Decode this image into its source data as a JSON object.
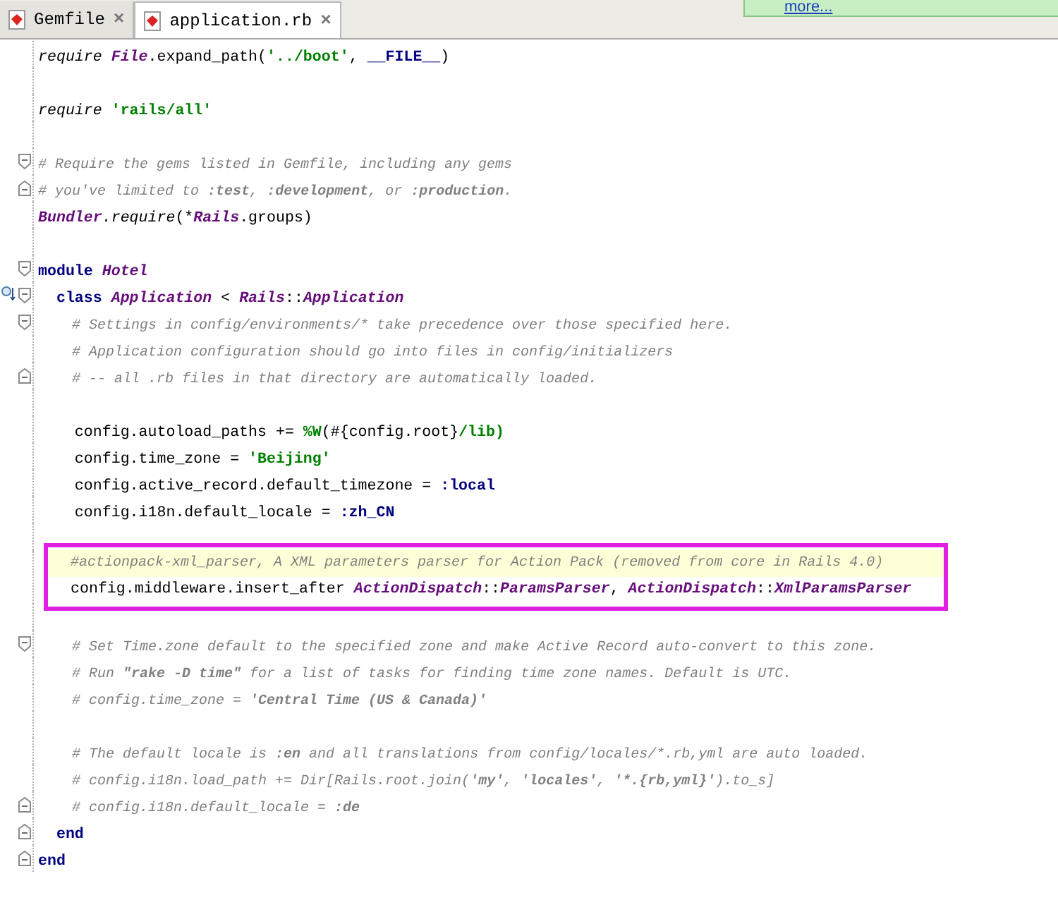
{
  "tabs": [
    {
      "label": "Gemfile",
      "close": "×",
      "selected": false
    },
    {
      "label": "application.rb",
      "close": "×",
      "selected": true
    }
  ],
  "notification": {
    "link": "more..."
  },
  "lines": [
    {
      "kind": "plain",
      "current": false,
      "segments": [
        {
          "kind": "meth",
          "text": "require "
        },
        {
          "kind": "const",
          "text": "File"
        },
        {
          "kind": "t",
          "text": ".expand_path("
        },
        {
          "kind": "str",
          "text": "'../boot'"
        },
        {
          "kind": "t",
          "text": ", "
        },
        {
          "kind": "kw",
          "text": "__FILE__"
        },
        {
          "kind": "t",
          "text": ")"
        }
      ]
    },
    {
      "kind": "plain",
      "current": false
    },
    {
      "kind": "plain",
      "current": false,
      "segments": [
        {
          "kind": "meth",
          "text": "require "
        },
        {
          "kind": "str",
          "text": "'rails/all'"
        }
      ]
    },
    {
      "kind": "plain",
      "current": false
    },
    {
      "kind": "opener",
      "current": false,
      "segments": [
        {
          "kind": "cmt",
          "text": "# Require the gems listed in Gemfile, including any gems"
        }
      ]
    },
    {
      "kind": "closer",
      "current": false,
      "segments": [
        {
          "kind": "cmt",
          "text": "# you've limited to "
        },
        {
          "kind": "cmtb",
          "text": ":test"
        },
        {
          "kind": "cmt",
          "text": ", "
        },
        {
          "kind": "cmtb",
          "text": ":development"
        },
        {
          "kind": "cmt",
          "text": ", or "
        },
        {
          "kind": "cmtb",
          "text": ":production"
        },
        {
          "kind": "cmt",
          "text": "."
        }
      ]
    },
    {
      "kind": "plain",
      "current": false,
      "segments": [
        {
          "kind": "const",
          "text": "Bundler"
        },
        {
          "kind": "meth",
          "text": ".require"
        },
        {
          "kind": "t",
          "text": "(*"
        },
        {
          "kind": "const",
          "text": "Rails"
        },
        {
          "kind": "t",
          "text": ".groups)"
        }
      ]
    },
    {
      "kind": "plain",
      "current": false
    },
    {
      "kind": "opener",
      "current": false,
      "segments": [
        {
          "kind": "kw",
          "text": "module "
        },
        {
          "kind": "const",
          "text": "Hotel"
        }
      ]
    },
    {
      "kind": "opener",
      "current": false,
      "overridden": true,
      "segments": [
        {
          "kind": "kw",
          "text": "  class "
        },
        {
          "kind": "const",
          "text": "Application"
        },
        {
          "kind": "t",
          "text": " < "
        },
        {
          "kind": "const",
          "text": "Rails"
        },
        {
          "kind": "t",
          "text": "::"
        },
        {
          "kind": "const",
          "text": "Application"
        }
      ]
    },
    {
      "kind": "opener",
      "current": false,
      "segments": [
        {
          "kind": "cmt",
          "text": "    # Settings in config/environments/* take precedence over those specified here."
        }
      ]
    },
    {
      "kind": "plain",
      "current": false,
      "segments": [
        {
          "kind": "cmt",
          "text": "    # Application configuration should go into files in config/initializers"
        }
      ]
    },
    {
      "kind": "closer",
      "current": false,
      "segments": [
        {
          "kind": "cmt",
          "text": "    # -- all .rb files in that directory are automatically loaded."
        }
      ]
    },
    {
      "kind": "plain",
      "current": false
    },
    {
      "kind": "plain",
      "current": false,
      "segments": [
        {
          "kind": "t",
          "text": "    config.autoload_paths += "
        },
        {
          "kind": "str",
          "text": "%W"
        },
        {
          "kind": "t",
          "text": "(#{config.root}"
        },
        {
          "kind": "str",
          "text": "/lib)"
        }
      ]
    },
    {
      "kind": "plain",
      "current": false,
      "segments": [
        {
          "kind": "t",
          "text": "    config.time_zone = "
        },
        {
          "kind": "str",
          "text": "'Beijing'"
        }
      ]
    },
    {
      "kind": "plain",
      "current": false,
      "segments": [
        {
          "kind": "t",
          "text": "    config.active_record.default_timezone = "
        },
        {
          "kind": "sym",
          "text": ":local"
        }
      ]
    },
    {
      "kind": "plain",
      "current": false,
      "segments": [
        {
          "kind": "t",
          "text": "    config.i18n.default_locale = "
        },
        {
          "kind": "sym",
          "text": ":zh_CN"
        }
      ]
    },
    {
      "kind": "plain",
      "current": false
    },
    {
      "kind": "box",
      "lines": [
        {
          "current": true,
          "segments": [
            {
              "kind": "cmt",
              "text": "#actionpack-xml_parser, A XML parameters parser for Action Pack (removed from core in Rails 4.0)"
            }
          ]
        },
        {
          "current": false,
          "segments": [
            {
              "kind": "t",
              "text": "config.middleware.insert_after "
            },
            {
              "kind": "const",
              "text": "ActionDispatch"
            },
            {
              "kind": "t",
              "text": "::"
            },
            {
              "kind": "const",
              "text": "ParamsParser"
            },
            {
              "kind": "t",
              "text": ", "
            },
            {
              "kind": "const",
              "text": "ActionDispatch"
            },
            {
              "kind": "t",
              "text": "::"
            },
            {
              "kind": "const",
              "text": "XmlParamsParser"
            }
          ]
        }
      ]
    },
    {
      "kind": "plain",
      "current": false
    },
    {
      "kind": "opener",
      "current": false,
      "segments": [
        {
          "kind": "cmt",
          "text": "    # Set Time.zone default to the specified zone and make Active Record auto-convert to this zone."
        }
      ]
    },
    {
      "kind": "plain",
      "current": false,
      "segments": [
        {
          "kind": "cmt",
          "text": "    # Run "
        },
        {
          "kind": "cmtb",
          "text": "\"rake -D time\""
        },
        {
          "kind": "cmt",
          "text": " for a list of tasks for finding time zone names. Default is UTC."
        }
      ]
    },
    {
      "kind": "plain",
      "current": false,
      "segments": [
        {
          "kind": "cmt",
          "text": "    # config.time_zone = "
        },
        {
          "kind": "cmtb",
          "text": "'Central Time (US & Canada)'"
        }
      ]
    },
    {
      "kind": "plain",
      "current": false
    },
    {
      "kind": "plain",
      "current": false,
      "segments": [
        {
          "kind": "cmt",
          "text": "    # The default locale is "
        },
        {
          "kind": "cmtb",
          "text": ":en"
        },
        {
          "kind": "cmt",
          "text": " and all translations from config/locales/*.rb,yml are auto loaded."
        }
      ]
    },
    {
      "kind": "plain",
      "current": false,
      "segments": [
        {
          "kind": "cmt",
          "text": "    # config.i18n.load_path += Dir[Rails.root.join("
        },
        {
          "kind": "cmtb",
          "text": "'my'"
        },
        {
          "kind": "cmt",
          "text": ", "
        },
        {
          "kind": "cmtb",
          "text": "'locales'"
        },
        {
          "kind": "cmt",
          "text": ", "
        },
        {
          "kind": "cmtb",
          "text": "'*.{rb,yml}'"
        },
        {
          "kind": "cmt",
          "text": ").to_s]"
        }
      ]
    },
    {
      "kind": "closer",
      "current": false,
      "segments": [
        {
          "kind": "cmt",
          "text": "    # config.i18n.default_locale = "
        },
        {
          "kind": "cmtb",
          "text": ":de"
        }
      ]
    },
    {
      "kind": "closer",
      "current": false,
      "segments": [
        {
          "kind": "kw",
          "text": "  end"
        }
      ]
    },
    {
      "kind": "closer",
      "current": false,
      "segments": [
        {
          "kind": "kw",
          "text": "end"
        }
      ]
    }
  ]
}
